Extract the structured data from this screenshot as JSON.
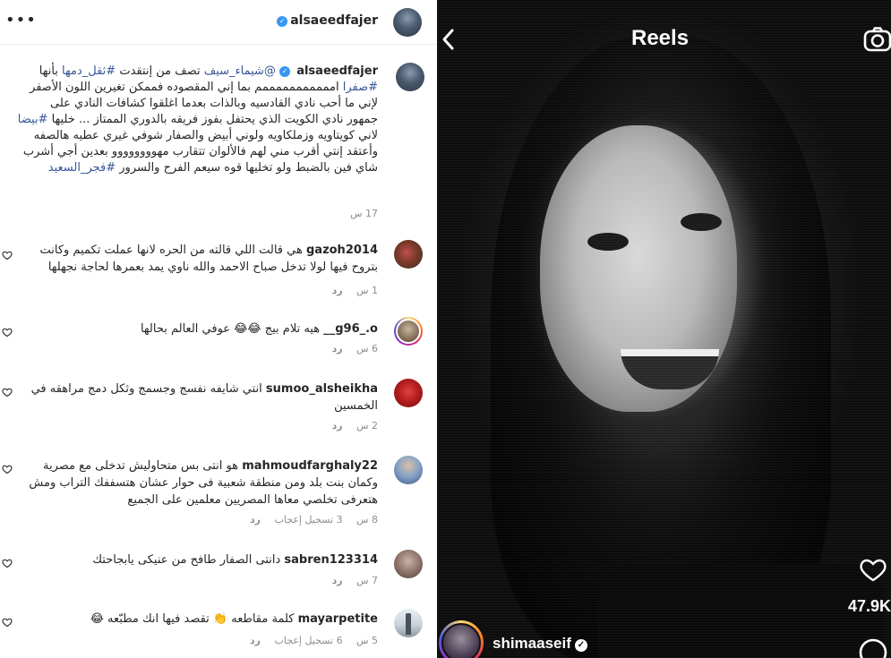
{
  "header": {
    "more_icon": "more-horizontal-icon",
    "username": "alsaeedfajer"
  },
  "caption": {
    "username": "alsaeedfajer",
    "mention": "@شيماء_سيف",
    "text_1": "تصف من إنتقدت",
    "hashtag_1": "#ثقل_دمها",
    "text_2": "بأنها",
    "hashtag_2": "#صفرا",
    "text_3": "امممممممممممم بما إني المقصوده فممكن تغيرين اللون الأصفر لإني ما أحب نادي القادسيه وبالذات بعدما اغلقوا كشافات النادي على جمهور نادي الكويت الذي يحتفل بفوز فريقه بالدوري الممتاز ... خليها",
    "hashtag_3": "#بيضا",
    "text_4": "لاني كويتاويه وزملكاويه ولوني أبيض والصفار شوفي غيري عطيه هالصفه وأعتقد إنتي أقرب مني لهم فالألوان تتقارب مهوووووووو بعدين أجي أشرب شاي فين بالضبط ولو تخليها قوه سيعم الفرح والسرور",
    "hashtag_4": "#فجر_السعيد",
    "time": "17 س"
  },
  "comments": [
    {
      "username": "gazoh2014",
      "text": "هي قالت اللي قالته من الحره لانها عملت تكميم وكانت بتروح فيها لولا تدخل صباح الاحمد والله ناوي يمد بعمرها لحاجة نجهلها",
      "time": "1 س",
      "likes": "",
      "reply": "رد"
    },
    {
      "username": "g96_.o__",
      "text": "هيه تلام بيج 😂😂 عوفي العالم بحالها",
      "time": "6 س",
      "likes": "",
      "reply": "رد"
    },
    {
      "username": "sumoo_alsheikha",
      "text": "انتي شايفه نفسج وجسمج وثكل دمج مراهقه في الخمسين",
      "time": "2 س",
      "likes": "",
      "reply": "رد"
    },
    {
      "username": "mahmoudfarghaly22",
      "text": "هو انتى بس متحاوليش تدخلى مع مصرية وكمان بنت بلد ومن منطقة شعبية فى حوار عشان هتسففك التراب ومش هتعرفى تخلصي معاها المصريين معلمين على الجميع",
      "time": "8 س",
      "likes": "3 تسجيل إعجاب",
      "reply": "رد"
    },
    {
      "username": "sabren123314",
      "text": "دانتى الصفار طافح من عنيكى يابجاحتك",
      "time": "7 س",
      "likes": "",
      "reply": "رد"
    },
    {
      "username": "mayarpetite",
      "text": "كلمة مقاطعه 👏 تقصد فيها انك مطبّعه 😂",
      "time": "5 س",
      "likes": "6 تسجيل إعجاب",
      "reply": "رد"
    }
  ],
  "reel": {
    "title": "Reels",
    "back_icon": "chevron-left-icon",
    "camera_icon": "camera-icon",
    "like_icon": "heart-icon",
    "like_count": "47.9",
    "like_count_suffix": "K",
    "username": "shimaaseif",
    "comment_icon": "comment-icon"
  },
  "colors": {
    "hashtag": "#385898",
    "verified": "#3897f0",
    "muted_text": "#8e8e8e",
    "reel_bg": "#111111"
  }
}
